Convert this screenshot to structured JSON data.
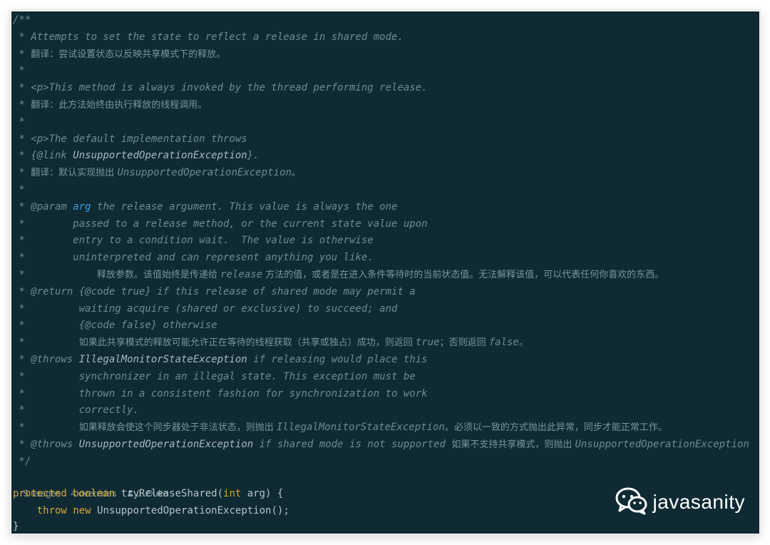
{
  "doc": {
    "l1": "/**",
    "l2": " * Attempts to set the state to reflect a release in shared mode.",
    "l3_prefix": " * ",
    "l3_zh": "翻译：尝试设置状态以反映共享模式下的释放。",
    "l4": " *",
    "l5": " * <p>This method is always invoked by the thread performing release.",
    "l6_prefix": " * ",
    "l6_zh": "翻译：此方法始终由执行释放的线程调用。",
    "l7": " *",
    "l8": " * <p>The default implementation throws",
    "l9_a": " * {@link ",
    "l9_b": "UnsupportedOperationException",
    "l9_c": "}.",
    "l10_prefix": " * ",
    "l10_zh": "翻译：默认实现抛出 ",
    "l10_b": "UnsupportedOperationException",
    "l10_zh2": "。",
    "l11": " *",
    "l12_a": " * @param ",
    "l12_b": "arg",
    "l12_c": " the release argument. This value is always the one",
    "l13": " *        passed to a release method, or the current state value upon",
    "l14": " *        entry to a condition wait.  The value is otherwise",
    "l15": " *        uninterpreted and can represent anything you like.",
    "l16_prefix": " *            ",
    "l16_zh1": "释放参数。该值始终是传递给 ",
    "l16_b": "release",
    "l16_zh2": " 方法的值，或者是在进入条件等待时的当前状态值。无法解释该值，可以代表任何你喜欢的东西。",
    "l17": " * @return {@code true} if this release of shared mode may permit a",
    "l18": " *         waiting acquire (shared or exclusive) to succeed; and",
    "l19": " *         {@code false} otherwise",
    "l20_prefix": " *         ",
    "l20_zh1": "如果此共享模式的释放可能允许正在等待的线程获取（共享或独占）成功，则返回 ",
    "l20_b": "true",
    "l20_zh2": "；否则返回 ",
    "l20_c": "false",
    "l20_zh3": "。",
    "l21_a": " * @throws ",
    "l21_b": "IllegalMonitorStateException",
    "l21_c": " if releasing would place this",
    "l22": " *         synchronizer in an illegal state. This exception must be",
    "l23": " *         thrown in a consistent fashion for synchronization to work",
    "l24": " *         correctly.",
    "l25_prefix": " *         ",
    "l25_zh1": "如果释放会使这个同步器处于非法状态，则抛出 ",
    "l25_b": "IllegalMonitorStateException",
    "l25_zh2": "。必须以一致的方式抛出此异常，同步才能正常工作。",
    "l26_a": " * @throws ",
    "l26_b": "UnsupportedOperationException",
    "l26_c": " if shared mode is not supported ",
    "l26_zh": "如果不支持共享模式，则抛出 ",
    "l26_d": "UnsupportedOperationException",
    "l27": " */"
  },
  "hints": {
    "usages": "5 usages",
    "overrides": "4 overrides",
    "author": "J. Duke"
  },
  "code": {
    "kw_protected": "protected",
    "kw_boolean": "boolean",
    "method_sig": " tryReleaseShared(",
    "kw_int": "int",
    "method_sig_end": " arg) {",
    "indent": "    ",
    "kw_throw": "throw",
    "kw_new": "new",
    "throw_rest": " UnsupportedOperationException();",
    "close": "}"
  },
  "watermark": {
    "icon": "wechat-icon",
    "text": "javasanity"
  },
  "colors": {
    "background": "#0f2a33",
    "comment": "#6e8a92",
    "keyword": "#d4a83a",
    "param": "#3f9be0",
    "code": "#b7c3c6"
  }
}
